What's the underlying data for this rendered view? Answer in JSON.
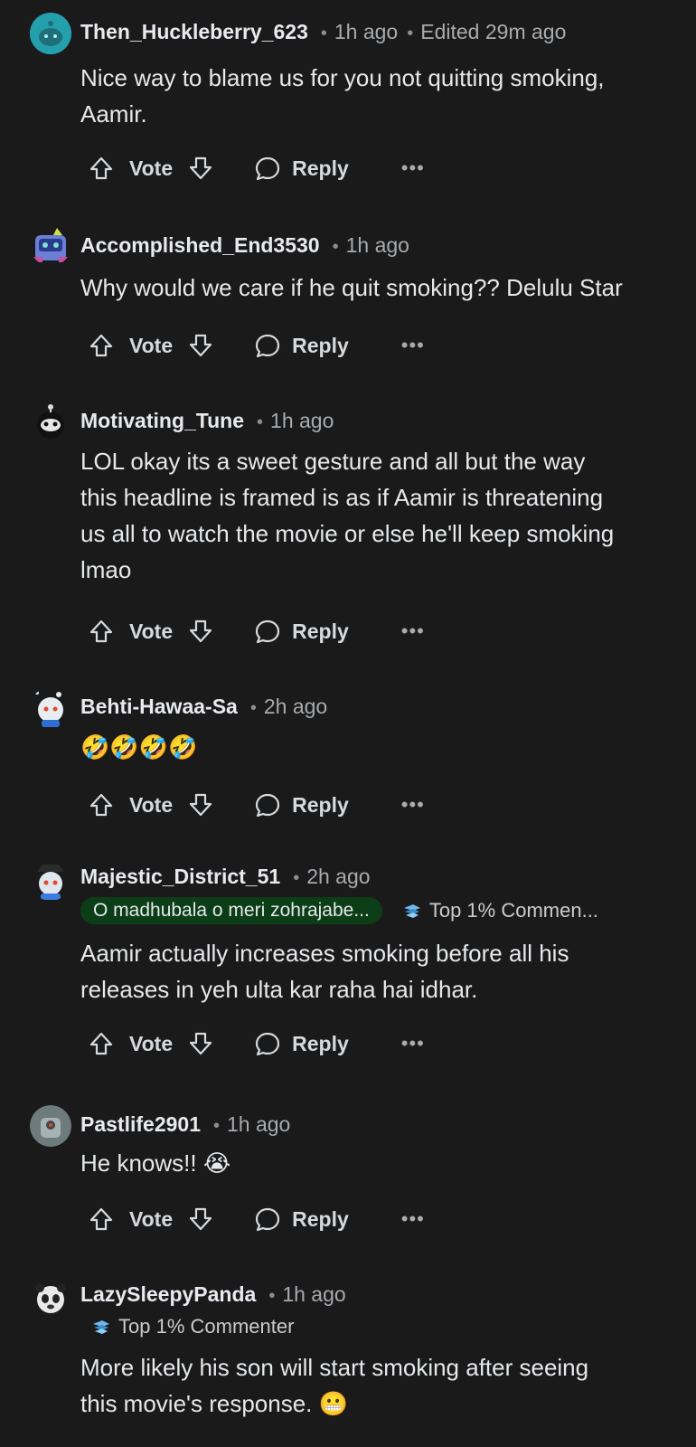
{
  "comments": [
    {
      "username": "Then_Huckleberry_623",
      "time": "1h ago",
      "edited": "Edited 29m ago",
      "lines": [
        "Nice way to blame us for you not quitting smoking,",
        "Aamir."
      ],
      "vote_label": "Vote",
      "reply_label": "Reply",
      "more_label": "•••",
      "avatar_icon": "snoo-teal-avatar"
    },
    {
      "username": "Accomplished_End3530",
      "time": "1h ago",
      "lines": [
        "Why would we care if he quit smoking?? Delulu Star"
      ],
      "vote_label": "Vote",
      "reply_label": "Reply",
      "more_label": "•••",
      "avatar_icon": "snoo-robot-avatar"
    },
    {
      "username": "Motivating_Tune",
      "time": "1h ago",
      "lines": [
        "LOL okay its a sweet gesture and all but the way",
        "this headline is framed is as if Aamir is threatening",
        "us all to watch the movie or else he'll keep smoking",
        "lmao"
      ],
      "vote_label": "Vote",
      "reply_label": "Reply",
      "more_label": "•••",
      "avatar_icon": "snoo-black-avatar"
    },
    {
      "username": "Behti-Hawaa-Sa",
      "time": "2h ago",
      "lines": [
        "🤣🤣🤣🤣"
      ],
      "vote_label": "Vote",
      "reply_label": "Reply",
      "more_label": "•••",
      "avatar_icon": "snoo-blue-avatar"
    },
    {
      "username": "Majestic_District_51",
      "time": "2h ago",
      "flair": "O madhubala o meri zohrajabe...",
      "badge": "Top 1% Commen...",
      "lines": [
        "Aamir actually increases smoking before all his",
        "releases in yeh ulta kar raha hai idhar."
      ],
      "vote_label": "Vote",
      "reply_label": "Reply",
      "more_label": "•••",
      "avatar_icon": "snoo-hat-avatar"
    },
    {
      "username": "Pastlife2901",
      "time": "1h ago",
      "lines": [
        "He knows!! 😭"
      ],
      "vote_label": "Vote",
      "reply_label": "Reply",
      "more_label": "•••",
      "avatar_icon": "snoo-grey-avatar"
    },
    {
      "username": "LazySleepyPanda",
      "time": "1h ago",
      "badge": "Top 1% Commenter",
      "lines": [
        "More likely his son will start smoking after seeing",
        "this movie's response. 😬"
      ],
      "avatar_icon": "snoo-panda-avatar"
    }
  ],
  "colors": {
    "background": "#1a1a1b",
    "flair_green": "#0b3d17",
    "text": "#d7dadc"
  }
}
